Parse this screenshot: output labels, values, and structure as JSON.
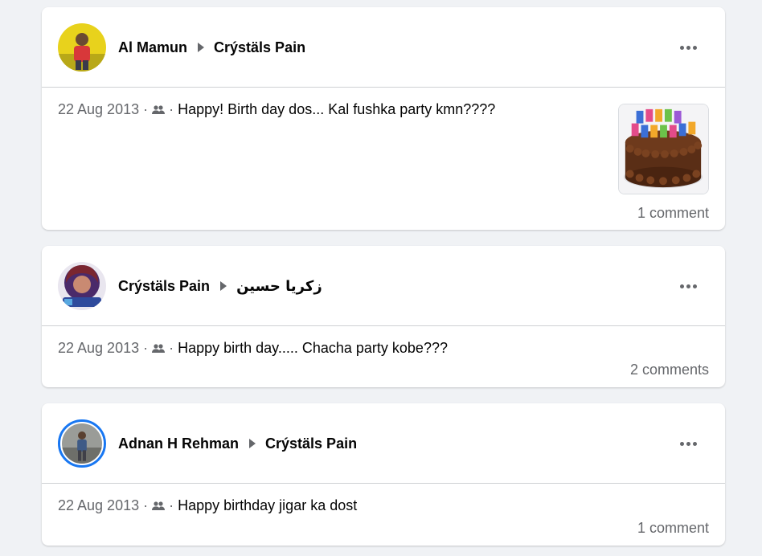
{
  "posts": [
    {
      "author": "Al Mamun",
      "target": "Crýstäls Pain",
      "date": "22 Aug 2013",
      "separator": "·",
      "message": "Happy! Birth day dos... Kal fushka party kmn????",
      "comments": "1 comment",
      "icons": {
        "audience": "friends-icon",
        "more": "more-options-icon"
      },
      "colors": {
        "avatar_bg": "#e8d21c"
      }
    },
    {
      "author": "Crýstäls Pain",
      "target": "زکریا حسین",
      "date": "22 Aug 2013",
      "separator": "·",
      "message": "Happy birth day..... Chacha party kobe???",
      "comments": "2 comments",
      "icons": {
        "audience": "friends-icon",
        "more": "more-options-icon"
      },
      "colors": {
        "avatar_bg": "#4a2a6a"
      }
    },
    {
      "author": "Adnan H Rehman",
      "target": "Crýstäls Pain",
      "date": "22 Aug 2013",
      "separator": "·",
      "message": "Happy birthday jigar ka dost",
      "comments": "1 comment",
      "icons": {
        "audience": "friends-icon",
        "more": "more-options-icon"
      },
      "colors": {
        "avatar_ring": "#1877f2"
      }
    }
  ],
  "colors": {
    "background": "#f0f2f5",
    "card": "#ffffff",
    "secondary_text": "#65676b",
    "primary_text": "#050505",
    "divider": "#ced0d4"
  }
}
